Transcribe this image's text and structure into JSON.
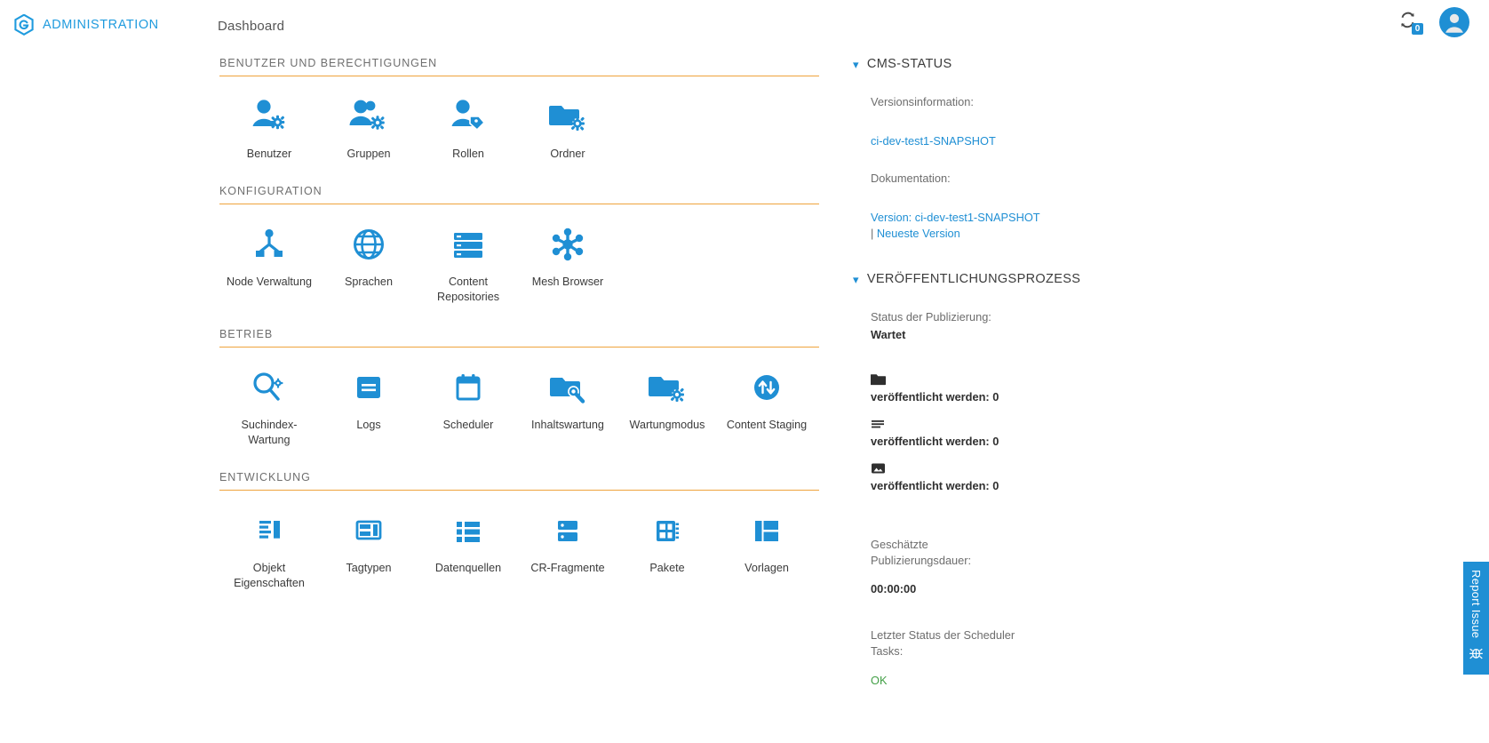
{
  "brand": {
    "name": "ADMINISTRATION",
    "logo_icon": "gentics-hex-logo-icon"
  },
  "header": {
    "breadcrumb": "Dashboard",
    "sync_icon": "sync-arrows-icon",
    "sync_badge": "0",
    "avatar_icon": "user-avatar-icon"
  },
  "sections": [
    {
      "title": "BENUTZER UND BERECHTIGUNGEN",
      "tiles": [
        {
          "label": "Benutzer",
          "icon": "user-gear-icon"
        },
        {
          "label": "Gruppen",
          "icon": "users-gear-icon"
        },
        {
          "label": "Rollen",
          "icon": "user-tag-icon"
        },
        {
          "label": "Ordner",
          "icon": "folder-gear-icon"
        }
      ]
    },
    {
      "title": "KONFIGURATION",
      "tiles": [
        {
          "label": "Node Verwaltung",
          "icon": "node-tree-icon"
        },
        {
          "label": "Sprachen",
          "icon": "globe-icon"
        },
        {
          "label": "Content Repositories",
          "icon": "database-list-icon"
        },
        {
          "label": "Mesh Browser",
          "icon": "mesh-nodes-icon"
        }
      ]
    },
    {
      "title": "BETRIEB",
      "tiles": [
        {
          "label": "Suchindex-Wartung",
          "icon": "search-gear-icon"
        },
        {
          "label": "Logs",
          "icon": "log-lines-icon"
        },
        {
          "label": "Scheduler",
          "icon": "calendar-icon"
        },
        {
          "label": "Inhaltswartung",
          "icon": "folder-wrench-icon"
        },
        {
          "label": "Wartungmodus",
          "icon": "folder-gear-icon"
        },
        {
          "label": "Content Staging",
          "icon": "arrows-updown-circle-icon"
        }
      ]
    },
    {
      "title": "ENTWICKLUNG",
      "tiles": [
        {
          "label": "Objekt Eigenschaften",
          "icon": "object-properties-icon"
        },
        {
          "label": "Tagtypen",
          "icon": "tagtype-layout-icon"
        },
        {
          "label": "Datenquellen",
          "icon": "datasource-list-icon"
        },
        {
          "label": "CR-Fragmente",
          "icon": "cr-fragment-icon"
        },
        {
          "label": "Pakete",
          "icon": "package-icon"
        },
        {
          "label": "Vorlagen",
          "icon": "template-icon"
        }
      ]
    }
  ],
  "panels": {
    "cms_status": {
      "title": "CMS-STATUS",
      "chevron_icon": "chevron-down-icon",
      "version_label": "Versionsinformation:",
      "version_value": "ci-dev-test1-SNAPSHOT",
      "docs_label": "Dokumentation:",
      "docs_version_link": "Version: ci-dev-test1-SNAPSHOT",
      "docs_separator": " | ",
      "docs_latest_link": "Neueste Version"
    },
    "publishing": {
      "title": "VERÖFFENTLICHUNGSPROZESS",
      "chevron_icon": "chevron-down-icon",
      "status_label": "Status der Publizierung:",
      "status_value": "Wartet",
      "counts": [
        {
          "icon": "folder-icon",
          "text": "veröffentlicht werden: 0"
        },
        {
          "icon": "page-lines-icon",
          "text": "veröffentlicht werden: 0"
        },
        {
          "icon": "image-icon",
          "text": "veröffentlicht werden: 0"
        }
      ],
      "duration_label": "Geschätzte Publizierungsdauer:",
      "duration_value": "00:00:00",
      "scheduler_label": "Letzter Status der Scheduler Tasks:",
      "scheduler_value": "OK"
    }
  },
  "report_tab": {
    "label": "Report Issue",
    "icon": "bug-icon"
  },
  "colors": {
    "accent_blue": "#1f8fd4",
    "rule_orange": "#efa33c",
    "ok_green": "#43a047",
    "label_gray": "#6d6d6d"
  }
}
